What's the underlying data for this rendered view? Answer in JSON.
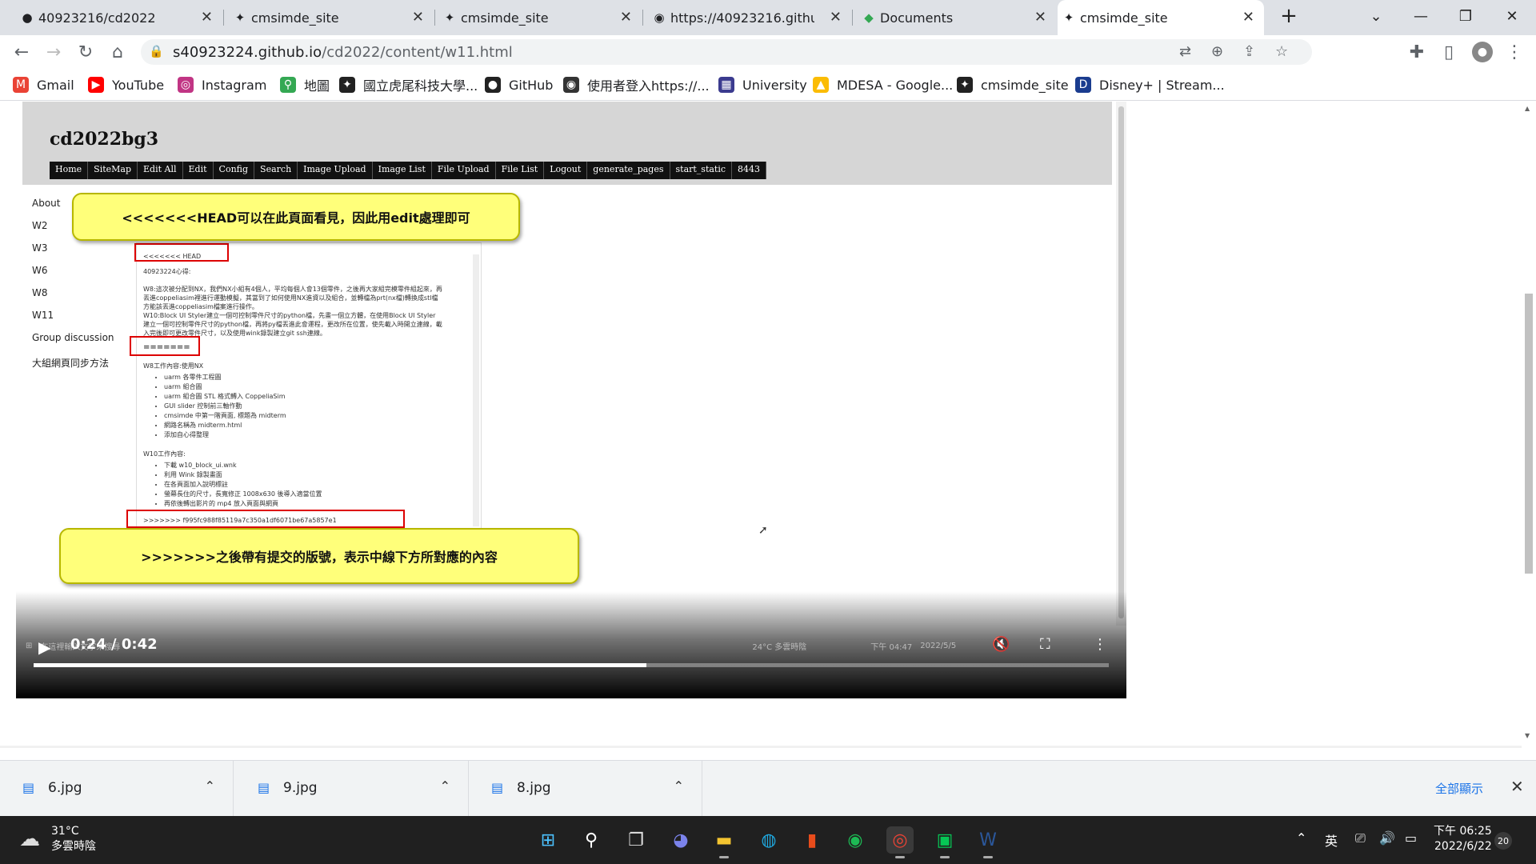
{
  "browser": {
    "tabs": [
      {
        "title": "40923216/cd2022",
        "icon": "github-icon",
        "active": false
      },
      {
        "title": "cmsimde_site",
        "icon": "cmsimde-icon",
        "active": false
      },
      {
        "title": "cmsimde_site",
        "icon": "cmsimde-icon",
        "active": false
      },
      {
        "title": "https://40923216.github.i",
        "icon": "globe-icon",
        "active": false
      },
      {
        "title": "Documents",
        "icon": "documents-icon",
        "active": false
      },
      {
        "title": "cmsimde_site",
        "icon": "cmsimde-icon",
        "active": true
      }
    ],
    "new_tab": "+",
    "url_host": "s40923224.github.io",
    "url_path": "/cd2022/content/w11.html",
    "bookmarks": [
      {
        "label": "Gmail",
        "icon": "gmail-icon",
        "color": "#ea4335",
        "glyph": "M"
      },
      {
        "label": "YouTube",
        "icon": "youtube-icon",
        "color": "#ff0000",
        "glyph": "▶"
      },
      {
        "label": "Instagram",
        "icon": "instagram-icon",
        "color": "#c13584",
        "glyph": "◎"
      },
      {
        "label": "地圖",
        "icon": "maps-icon",
        "color": "#34a853",
        "glyph": "⚲"
      },
      {
        "label": "國立虎尾科技大學...",
        "icon": "cmsimde-icon",
        "color": "#222",
        "glyph": "✦"
      },
      {
        "label": "GitHub",
        "icon": "github-icon",
        "color": "#222",
        "glyph": "●"
      },
      {
        "label": "使用者登入https://...",
        "icon": "globe-icon",
        "color": "#333",
        "glyph": "◉"
      },
      {
        "label": "University",
        "icon": "university-icon",
        "color": "#3b3b8f",
        "glyph": "▦"
      },
      {
        "label": "MDESA - Google...",
        "icon": "drive-icon",
        "color": "#fbbc04",
        "glyph": "▲"
      },
      {
        "label": "cmsimde_site",
        "icon": "cmsimde-icon",
        "color": "#222",
        "glyph": "✦"
      },
      {
        "label": "Disney+ | Stream...",
        "icon": "disney-icon",
        "color": "#1a3c8f",
        "glyph": "D"
      }
    ]
  },
  "video_page": {
    "site_title": "cd2022bg3",
    "nav": [
      "Home",
      "SiteMap",
      "Edit All",
      "Edit",
      "Config",
      "Search",
      "Image Upload",
      "Image List",
      "File Upload",
      "File List",
      "Logout",
      "generate_pages",
      "start_static",
      "8443"
    ],
    "side_menu": [
      "About",
      "W2",
      "W3",
      "W6",
      "W8",
      "W11",
      "Group discussion",
      "大組網頁同步方法"
    ],
    "callout_top": "<<<<<<<HEAD可以在此頁面看見，因此用edit處理即可",
    "callout_bottom": ">>>>>>>之後帶有提交的版號，表示中線下方所對應的內容",
    "editor_lines": {
      "head": "<<<<<<< HEAD",
      "student": "40923224心得:",
      "p1a": "W8:這次被分配到NX，我們NX小組有4個人，平均每個人會13個零件，之後再大家組完模零件組起來，再",
      "p1b": "丟進coppeliasim裡進行運動模擬，其當到了如何使用NX進資以及組合，並轉檔為prt(nx檔)轉換成stl檔",
      "p1c": "方能該丟進coppeliasim檔案進行操作。",
      "p2a": "W10:Block UI Styler建立一個可控制零件尺寸的python檔，先畫一個立方體，在使用Block UI Styler",
      "p2b": "建立一個可控制零件尺寸的python檔，再將py檔丟進此會運程，更改所在位置，使先載入時開立連線，載",
      "p2c": "入完後即可更改零件尺寸，以及使用wink錄製建立git ssh連線。",
      "divider": "=======",
      "w8_title": "W8工作內容:使用NX",
      "w8_items": [
        "uarm 各零件工程圖",
        "uarm 組合圖",
        "uarm 組合圖 STL 格式轉入 CoppeliaSim",
        "GUI slider 控制前三軸作動",
        "cmsimde 中第一階頁面, 標題為 midterm",
        "網路名稱為 midterm.html",
        "添加自心得整理"
      ],
      "w10_title": "W10工作內容:",
      "w10_items": [
        "下載 w10_block_ui.wnk",
        "利用 Wink 錄製畫面",
        "在各頁面加入說明標註",
        "螢幕長住的尺寸，長寬修正 1008x630 後導入適當位置",
        "再依後轉出影片的 mp4 放入頁面與網頁"
      ],
      "tail": ">>>>>>> f995fc988f85119a7c350a1df6071be67a5857e1"
    },
    "inner_taskbar": {
      "search": "在這裡輸入文字來搜尋",
      "weather": "24°C 多雲時陰",
      "clock": "下午 04:47",
      "date": "2022/5/5"
    },
    "player": {
      "time": "0:24 / 0:42",
      "progress": 0.57
    }
  },
  "downloads": {
    "files": [
      "6.jpg",
      "9.jpg",
      "8.jpg"
    ],
    "show_all": "全部顯示",
    "close": "✕"
  },
  "taskbar": {
    "temp": "31°C",
    "weather": "多雲時陰",
    "ime": "英",
    "time": "下午 06:25",
    "date": "2022/6/22",
    "notifications": "20",
    "apps": [
      {
        "name": "start-icon",
        "glyph": "⊞",
        "color": "#4cc2ff"
      },
      {
        "name": "search-icon",
        "glyph": "⚲",
        "color": "#ffffff"
      },
      {
        "name": "task-view-icon",
        "glyph": "❐",
        "color": "#e0e0e0"
      },
      {
        "name": "teams-chat-icon",
        "glyph": "◕",
        "color": "#7b83eb"
      },
      {
        "name": "file-explorer-icon",
        "glyph": "▬",
        "color": "#f4c430"
      },
      {
        "name": "edge-icon",
        "glyph": "◍",
        "color": "#1fa9e0"
      },
      {
        "name": "office-icon",
        "glyph": "▮",
        "color": "#e84c1b"
      },
      {
        "name": "spotify-icon",
        "glyph": "◉",
        "color": "#1db954"
      },
      {
        "name": "chrome-icon",
        "glyph": "◎",
        "color": "#ea4335"
      },
      {
        "name": "line-icon",
        "glyph": "▣",
        "color": "#06c755"
      },
      {
        "name": "word-icon",
        "glyph": "W",
        "color": "#2b579a"
      }
    ]
  }
}
